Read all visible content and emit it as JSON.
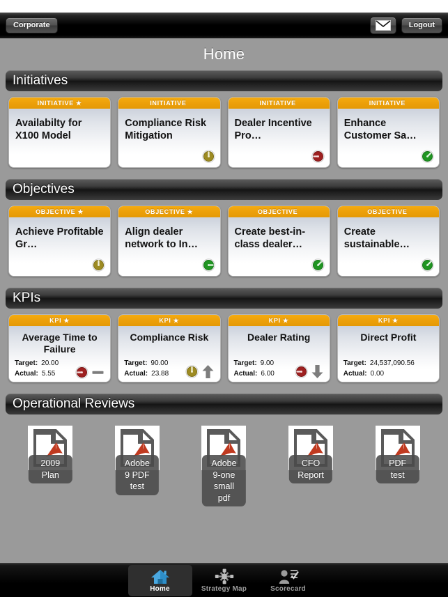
{
  "topbar": {
    "org_button": "Corporate",
    "mail_icon": "envelope-icon",
    "logout_button": "Logout"
  },
  "page": {
    "title": "Home"
  },
  "sections": [
    {
      "id": "initiatives",
      "title": "Initiatives",
      "cards": [
        {
          "kind": "INITIATIVE",
          "starred": true,
          "star": "★",
          "title": "Availabilty for X100 Model",
          "status": "none"
        },
        {
          "kind": "INITIATIVE",
          "starred": false,
          "star": "",
          "title": "Compliance Risk Mitigation",
          "status": "yellow-up"
        },
        {
          "kind": "INITIATIVE",
          "starred": false,
          "star": "",
          "title": "Dealer Incentive Pro…",
          "status": "red-left"
        },
        {
          "kind": "INITIATIVE",
          "starred": false,
          "star": "",
          "title": "Enhance Customer Sa…",
          "status": "green-upright"
        }
      ]
    },
    {
      "id": "objectives",
      "title": "Objectives",
      "cards": [
        {
          "kind": "OBJECTIVE",
          "starred": true,
          "star": "★",
          "title": "Achieve Profitable Gr…",
          "status": "yellow-up"
        },
        {
          "kind": "OBJECTIVE",
          "starred": true,
          "star": "★",
          "title": "Align dealer network to In…",
          "status": "green-right"
        },
        {
          "kind": "OBJECTIVE",
          "starred": false,
          "star": "",
          "title": "Create best-in-class dealer…",
          "status": "green-upright"
        },
        {
          "kind": "OBJECTIVE",
          "starred": false,
          "star": "",
          "title": "Create sustainable…",
          "status": "green-upright"
        }
      ]
    }
  ],
  "kpi_section": {
    "title": "KPIs",
    "kind": "KPI",
    "star": "★",
    "target_label": "Target:",
    "actual_label": "Actual:",
    "cards": [
      {
        "title": "Average Time to Failure",
        "target": "20.00",
        "actual": "5.55",
        "status": "red-left",
        "trend": "flat"
      },
      {
        "title": "Compliance Risk",
        "target": "90.00",
        "actual": "23.88",
        "status": "yellow-up",
        "trend": "up"
      },
      {
        "title": "Dealer Rating",
        "target": "9.00",
        "actual": "6.00",
        "status": "red-left",
        "trend": "down"
      },
      {
        "title": "Direct Profit",
        "target": "24,537,090.56",
        "actual": "0.00",
        "status": "none",
        "trend": "none"
      }
    ]
  },
  "reviews_section": {
    "title": "Operational Reviews",
    "items": [
      {
        "label": "2009 Plan",
        "icon": "pdf-file-icon"
      },
      {
        "label": "Adobe 9 PDF test",
        "icon": "pdf-file-icon"
      },
      {
        "label": "Adobe 9-one small pdf",
        "icon": "pdf-file-icon"
      },
      {
        "label": "CFO Report",
        "icon": "pdf-file-icon"
      },
      {
        "label": "PDF test",
        "icon": "pdf-file-icon"
      }
    ]
  },
  "tabbar": {
    "tabs": [
      {
        "label": "Home",
        "icon": "home-icon",
        "active": true
      },
      {
        "label": "Strategy Map",
        "icon": "network-icon",
        "active": false
      },
      {
        "label": "Scorecard",
        "icon": "scorecard-icon",
        "active": false
      }
    ]
  },
  "colors": {
    "accent_header": "#eda00a",
    "status_green": "#209522",
    "status_yellow": "#9d8b22",
    "status_red": "#9e2020",
    "page_bg": "#9a9a9a"
  }
}
